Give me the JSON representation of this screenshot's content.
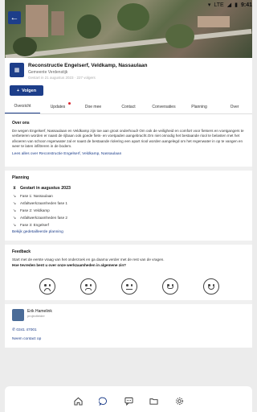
{
  "status_bar": {
    "network": "LTE",
    "time": "9:41"
  },
  "header": {
    "title": "Reconstructie Engelserf, Veldkamp, Nassaulaan",
    "organization": "Gemeente Verdenstijk",
    "meta": "Gestart in 21 augustus 2023  ·  227 volgers",
    "follow_label": "Volgen"
  },
  "tabs": [
    {
      "label": "Overzicht",
      "active": true
    },
    {
      "label": "Updates",
      "badge": true
    },
    {
      "label": "Doe mee"
    },
    {
      "label": "Contact"
    },
    {
      "label": "Conversaties"
    },
    {
      "label": "Planning"
    },
    {
      "label": "Over"
    }
  ],
  "over_ons": {
    "title": "Over ons",
    "body": "De wegen Engelserf, Nassaulaan en Veldkamp zijn toe aan groot onderhoud! Om ook de veiligheid en comfort voor fietsers en voetgangers te verbeteren worden er naast de rijbaan ook goede fiets- en voetpaden aangebracht.Om niet onnodig het bestaande riool te belasten met het afvoeren van schoon regenwater zal er naast de bestaande riolering een apart riool worden aangelegd om het regenwater in op te vangen en weer te laten infiltreren in de bodem.",
    "read_more": "Lees alles over Reconstructie Engelserf, Veldkamp, Nassaulaan"
  },
  "planning": {
    "title": "Planning",
    "current": "Gestart in augustus 2023",
    "items": [
      "Fase 1: Nassaulaan",
      "Asfaltwerkzaamheden fase 1",
      "Fase 2: Veldkamp",
      "Asfaltwerkzaamheden fase 2",
      "Fase 3: Engelserf"
    ],
    "link": "Bekijk gedetailleerde planning"
  },
  "feedback": {
    "title": "Feedback",
    "intro": "Start met de eerste vraag van het onderzoek en ga daarna verder met de rest van de vragen.",
    "question": "Hoe tevreden bent u over onze werkzaamheden in algemene zin?"
  },
  "contact": {
    "name": "Erik Hamelink",
    "role": "projectleider",
    "phone": "0341 47001",
    "link": "Neem contact op"
  },
  "colors": {
    "accent": "#1d3e8a",
    "badge": "#d9262e"
  }
}
